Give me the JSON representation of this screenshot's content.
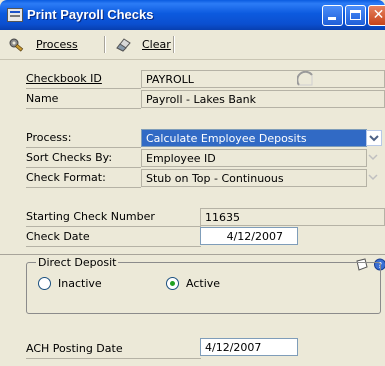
{
  "window": {
    "title": "Print Payroll Checks"
  },
  "toolbar": {
    "process_label": "Process",
    "clear_label": "Clear"
  },
  "form": {
    "checkbook_id_label": "Checkbook ID",
    "checkbook_id_value": "PAYROLL",
    "name_label": "Name",
    "name_value": "Payroll - Lakes Bank",
    "process_label": "Process:",
    "process_value": "Calculate Employee Deposits",
    "sort_label": "Sort Checks By:",
    "sort_value": "Employee ID",
    "format_label": "Check Format:",
    "format_value": "Stub on Top - Continuous",
    "start_check_label": "Starting Check Number",
    "start_check_value": "11635",
    "check_date_label": "Check Date",
    "check_date_value": "4/12/2007",
    "direct_deposit_title": "Direct Deposit",
    "inactive_label": "Inactive",
    "active_label": "Active",
    "ach_label": "ACH Posting Date",
    "ach_value": "4/12/2007"
  },
  "icons": {
    "title": "payroll-window-icon",
    "process": "gear-wrench-icon",
    "clear": "eraser-icon",
    "lookup": "checkbook-lookup-icon",
    "note": "note-icon",
    "help": "help-icon"
  },
  "colors": {
    "titlebar": "#0b4fd0",
    "selection": "#316ac5",
    "radio_active": "#21a121"
  }
}
